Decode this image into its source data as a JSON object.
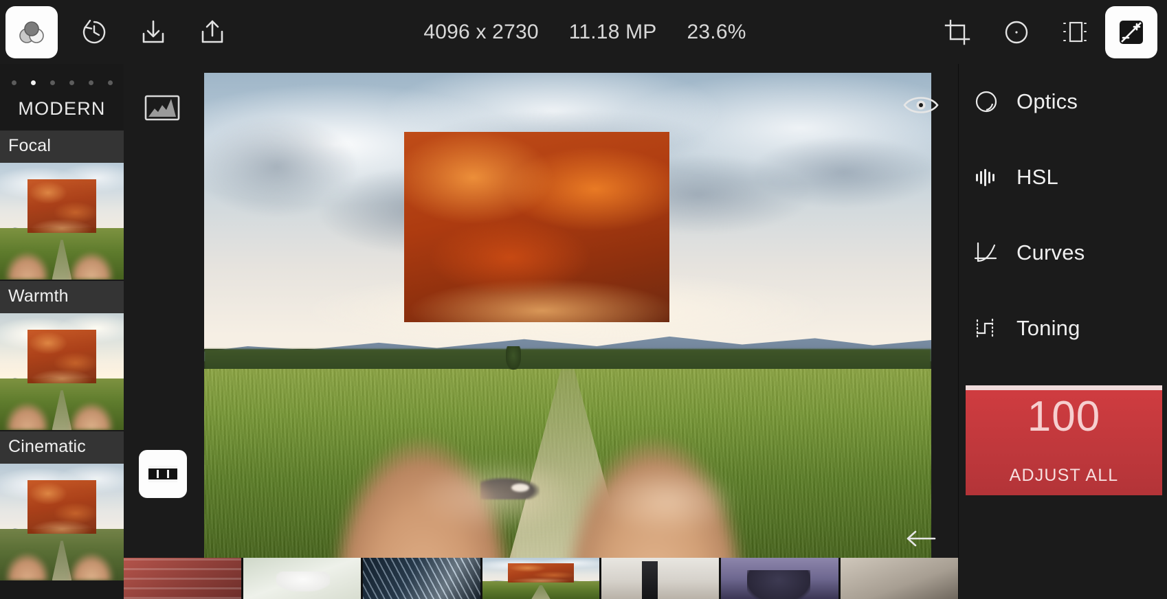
{
  "topbar": {
    "left_buttons": [
      {
        "name": "color-wheels-icon",
        "label": "Color",
        "active": true
      },
      {
        "name": "history-undo-icon",
        "label": "History"
      },
      {
        "name": "download-icon",
        "label": "Download"
      },
      {
        "name": "share-icon",
        "label": "Share"
      }
    ],
    "info": {
      "dimensions": "4096 x 2730",
      "megapixels": "11.18 MP",
      "zoom": "23.6%"
    },
    "right_buttons": [
      {
        "name": "crop-icon",
        "label": "Crop"
      },
      {
        "name": "radial-mask-icon",
        "label": "Radial"
      },
      {
        "name": "frame-icon",
        "label": "Frame"
      },
      {
        "name": "adjust-icon",
        "label": "Adjust",
        "active": true
      }
    ]
  },
  "presets": {
    "category": "MODERN",
    "page_dots": 6,
    "active_dot": 1,
    "items": [
      {
        "label": "Focal"
      },
      {
        "label": "Warmth"
      },
      {
        "label": "Cinematic"
      }
    ]
  },
  "left_rail": {
    "histogram_icon": "histogram-icon",
    "filmstrip_toggle_icon": "filmstrip-icon",
    "filmstrip_toggle_active": true
  },
  "canvas": {
    "compare_icon": "eye-icon",
    "back_icon": "back-arrow-icon",
    "selection_active": true
  },
  "tools": {
    "items": [
      {
        "label": "Optics",
        "icon": "optics-icon"
      },
      {
        "label": "HSL",
        "icon": "hsl-icon"
      },
      {
        "label": "Curves",
        "icon": "curves-icon"
      },
      {
        "label": "Toning",
        "icon": "toning-icon"
      }
    ],
    "adjust_all": {
      "value": "100",
      "label": "ADJUST ALL",
      "color": "#c43a3e",
      "fill_percent": 100
    }
  },
  "filmstrip": {
    "selected_index": 3,
    "thumbs": [
      {
        "name": "thumb-red-building",
        "style": "f-red"
      },
      {
        "name": "thumb-white-bunny",
        "style": "f-bunny"
      },
      {
        "name": "thumb-architecture-clock",
        "style": "f-arch"
      },
      {
        "name": "thumb-landscape-selected",
        "style": "mini-photo"
      },
      {
        "name": "thumb-city-person",
        "style": "f-city"
      },
      {
        "name": "thumb-purple-portrait",
        "style": "f-purple"
      },
      {
        "name": "thumb-neutral",
        "style": "f-last"
      }
    ]
  },
  "colors": {
    "background": "#1b1b1b",
    "panel": "#191919",
    "accent_red": "#c43a3e",
    "selection_yellow": "#ffdc28",
    "text": "#e8e8e8"
  }
}
